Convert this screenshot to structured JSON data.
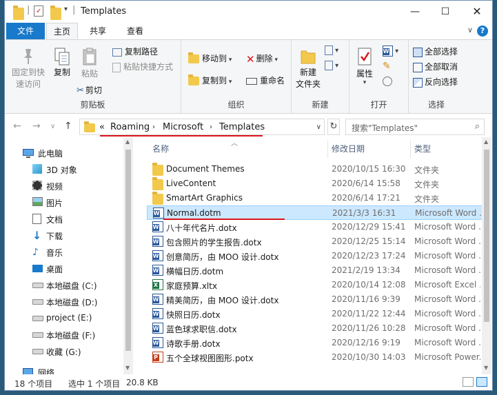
{
  "window": {
    "title": "Templates"
  },
  "tabs": [
    {
      "label": "文件"
    },
    {
      "label": "主页"
    },
    {
      "label": "共享"
    },
    {
      "label": "查看"
    }
  ],
  "ribbon": {
    "clipboard": {
      "pin": "固定到快",
      "pin2": "速访问",
      "copy": "复制",
      "paste": "粘贴",
      "copy_path": "复制路径",
      "paste_shortcut": "粘贴快捷方式",
      "cut": "剪切",
      "label": "剪贴板"
    },
    "organize": {
      "move_to": "移动到",
      "copy_to": "复制到",
      "delete": "删除",
      "rename": "重命名",
      "label": "组织"
    },
    "new": {
      "new_folder": "新建",
      "new_folder2": "文件夹",
      "label": "新建"
    },
    "open": {
      "properties": "属性",
      "label": "打开"
    },
    "select": {
      "select_all": "全部选择",
      "select_none": "全部取消",
      "invert": "反向选择",
      "label": "选择"
    }
  },
  "address": {
    "overflow": "«",
    "crumbs": [
      "Roaming",
      "Microsoft",
      "Templates"
    ],
    "search_placeholder": "搜索\"Templates\""
  },
  "nav": [
    {
      "label": "此电脑",
      "icon": "pc-icon"
    },
    {
      "label": "3D 对象",
      "icon": "cube-icon"
    },
    {
      "label": "视频",
      "icon": "video-icon"
    },
    {
      "label": "图片",
      "icon": "pictures-icon"
    },
    {
      "label": "文档",
      "icon": "documents-icon"
    },
    {
      "label": "下载",
      "icon": "download-icon"
    },
    {
      "label": "音乐",
      "icon": "music-icon"
    },
    {
      "label": "桌面",
      "icon": "desktop-icon"
    },
    {
      "label": "本地磁盘 (C:)",
      "icon": "drive-icon"
    },
    {
      "label": "本地磁盘 (D:)",
      "icon": "drive-icon"
    },
    {
      "label": "project (E:)",
      "icon": "drive-icon"
    },
    {
      "label": "本地磁盘 (F:)",
      "icon": "drive-icon"
    },
    {
      "label": "收藏 (G:)",
      "icon": "drive-icon"
    },
    {
      "label": "网络",
      "icon": "network-icon"
    }
  ],
  "columns": {
    "name": "名称",
    "date": "修改日期",
    "type": "类型"
  },
  "files": [
    {
      "name": "Document Themes",
      "date": "2020/10/15 16:30",
      "type": "文件夹",
      "icon": "folder"
    },
    {
      "name": "LiveContent",
      "date": "2020/6/14 15:58",
      "type": "文件夹",
      "icon": "folder"
    },
    {
      "name": "SmartArt Graphics",
      "date": "2020/6/14 17:21",
      "type": "文件夹",
      "icon": "folder"
    },
    {
      "name": "Normal.dotm",
      "date": "2021/3/3 16:31",
      "type": "Microsoft Word ...",
      "icon": "word"
    },
    {
      "name": "八十年代名片.dotx",
      "date": "2020/12/29 15:41",
      "type": "Microsoft Word ...",
      "icon": "word"
    },
    {
      "name": "包含照片的学生报告.dotx",
      "date": "2020/12/25 15:14",
      "type": "Microsoft Word ...",
      "icon": "word"
    },
    {
      "name": "创意简历，由 MOO 设计.dotx",
      "date": "2020/12/23 17:24",
      "type": "Microsoft Word ...",
      "icon": "word"
    },
    {
      "name": "横幅日历.dotm",
      "date": "2021/2/19 13:34",
      "type": "Microsoft Word ...",
      "icon": "word"
    },
    {
      "name": "家庭预算.xltx",
      "date": "2020/10/14 12:08",
      "type": "Microsoft Excel ...",
      "icon": "excel"
    },
    {
      "name": "精美简历，由 MOO 设计.dotx",
      "date": "2020/11/16 9:39",
      "type": "Microsoft Word ...",
      "icon": "word"
    },
    {
      "name": "快照日历.dotx",
      "date": "2020/11/22 12:44",
      "type": "Microsoft Word ...",
      "icon": "word"
    },
    {
      "name": "蓝色球求职信.dotx",
      "date": "2020/11/26 10:28",
      "type": "Microsoft Word ...",
      "icon": "word"
    },
    {
      "name": "诗歌手册.dotx",
      "date": "2020/12/16 9:19",
      "type": "Microsoft Word ...",
      "icon": "word"
    },
    {
      "name": "五个全球视图图形.potx",
      "date": "2020/10/30 14:03",
      "type": "Microsoft Power...",
      "icon": "ppt"
    }
  ],
  "status": {
    "count": "18 个项目",
    "selected": "选中 1 个项目",
    "size": "20.8 KB"
  },
  "colors": {
    "accent": "#1979ca",
    "selection": "#cce8ff",
    "annotation": "#d9141b"
  }
}
